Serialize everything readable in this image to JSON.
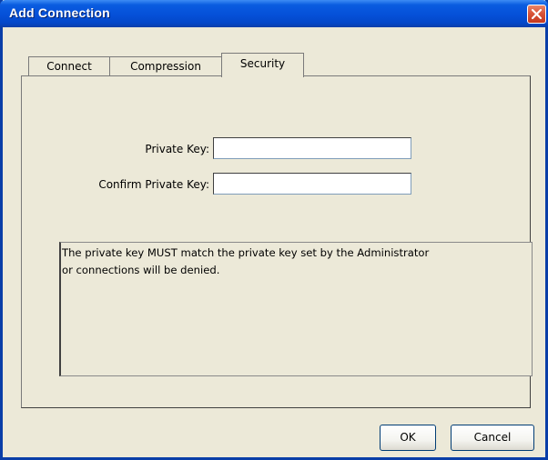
{
  "window": {
    "title": "Add Connection"
  },
  "tabs": [
    {
      "label": "Connect",
      "active": false
    },
    {
      "label": "Compression",
      "active": false
    },
    {
      "label": "Security",
      "active": true
    }
  ],
  "form": {
    "private_key": {
      "label": "Private Key:",
      "value": "",
      "placeholder": ""
    },
    "confirm_private_key": {
      "label": "Confirm Private Key:",
      "value": "",
      "placeholder": ""
    }
  },
  "info": {
    "text": "The private key MUST match the private key set by the Administrator\nor connections will be denied."
  },
  "buttons": {
    "ok": "OK",
    "cancel": "Cancel"
  },
  "colors": {
    "titlebar": "#0550d8",
    "dialog_bg": "#ece9d8",
    "close": "#d9553a"
  }
}
